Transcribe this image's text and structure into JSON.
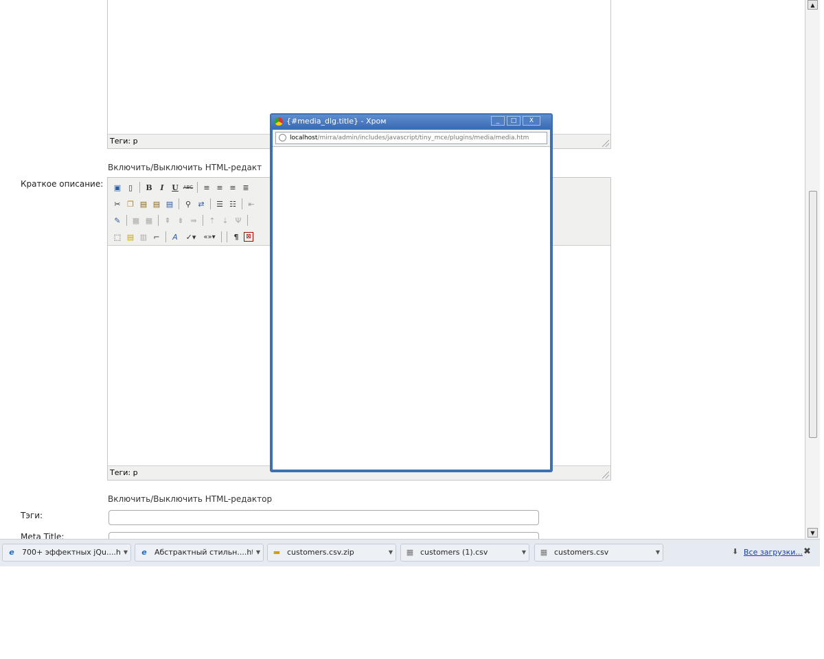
{
  "editor_top": {
    "statusbar_label": "Теги: p"
  },
  "toggle_html_1": "Включить/Выключить HTML-редакт",
  "short_description": {
    "label": "Краткое описание:",
    "statusbar_label": "Теги: p",
    "toolbar": {
      "row1": [
        "save-icon",
        "new-document-icon",
        "|",
        "bold-icon",
        "italic-icon",
        "underline-icon",
        "strikethrough-icon",
        "|",
        "align-left-icon",
        "align-center-icon",
        "align-right-icon",
        "align-justify-icon"
      ],
      "row2": [
        "cut-icon",
        "copy-icon",
        "paste-icon",
        "paste-text-icon",
        "paste-word-icon",
        "|",
        "find-icon",
        "replace-icon",
        "|",
        "bullet-list-icon",
        "numbered-list-icon",
        "|",
        "outdent-icon"
      ],
      "row3": [
        "edit-icon",
        "|",
        "table-icon",
        "table-props-icon",
        "|",
        "row-before-icon",
        "row-after-icon",
        "delete-row-icon",
        "|",
        "col-before-icon",
        "col-after-icon",
        "delete-col-icon",
        "|"
      ],
      "row4": [
        "select-all-icon",
        "layer-icon",
        "layer-forward-icon",
        "crop-icon",
        "|",
        "style-icon",
        "spellcheck-icon",
        "quote-icon",
        "|",
        "|",
        "paragraph-icon",
        "media-icon"
      ],
      "glyphs": {
        "bold-icon": "B",
        "italic-icon": "I",
        "underline-icon": "U",
        "strikethrough-icon": "ABC",
        "align-left-icon": "≡",
        "align-center-icon": "≡",
        "align-right-icon": "≡",
        "align-justify-icon": "≣",
        "cut-icon": "✂",
        "find-icon": "🔍",
        "bullet-list-icon": "☰",
        "numbered-list-icon": "☰",
        "paragraph-icon": "¶",
        "quote-icon": "«»",
        "spellcheck-icon": "✓"
      }
    }
  },
  "toggle_html_2": "Включить/Выключить HTML-редактор",
  "tags": {
    "label": "Тэги:",
    "value": ""
  },
  "meta_title": {
    "label": "Meta Title:",
    "value": ""
  },
  "popup": {
    "title": "{#media_dlg.title} - Хром",
    "url_host": "localhost",
    "url_path": "/mirra/admin/includes/javascript/tiny_mce/plugins/media/media.htm",
    "buttons": {
      "minimize": "_",
      "maximize": "□",
      "close": "X"
    }
  },
  "downloads": {
    "items": [
      {
        "name": "700+ эффектных jQu....htm",
        "icon": "ie-icon"
      },
      {
        "name": "Абстрактный стильн....htm",
        "icon": "ie-icon"
      },
      {
        "name": "customers.csv.zip",
        "icon": "zip-icon"
      },
      {
        "name": "customers (1).csv",
        "icon": "csv-icon"
      },
      {
        "name": "customers.csv",
        "icon": "csv-icon"
      }
    ],
    "all_downloads": "Все загрузки...",
    "close": "✖"
  },
  "scrollbar": {
    "up": "▲",
    "down": "▼"
  },
  "colors": {
    "popup_frame": "#3d6fb5",
    "toolbar_bg": "#f0f0ee",
    "download_bar_bg": "#e6ebf2"
  }
}
